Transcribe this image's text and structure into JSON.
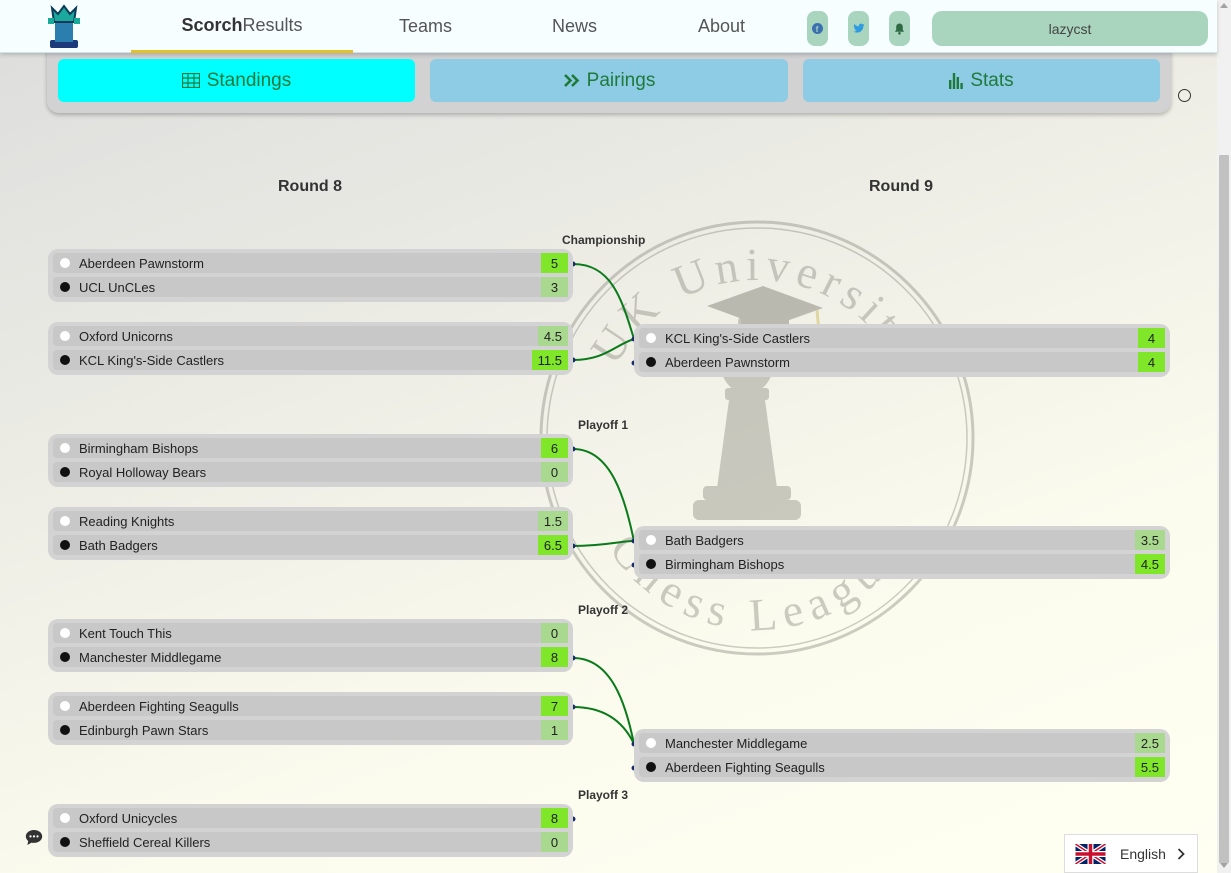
{
  "navbar": {
    "brand_bold": "Scorch",
    "brand_rest": "Results",
    "links": [
      {
        "label": "Teams"
      },
      {
        "label": "News"
      },
      {
        "label": "About"
      }
    ],
    "user_label": "lazycst"
  },
  "tabs": [
    {
      "label": "Standings",
      "icon": "grid-icon",
      "active": true
    },
    {
      "label": "Pairings",
      "icon": "chevrons-right-icon",
      "active": false
    },
    {
      "label": "Stats",
      "icon": "bar-chart-icon",
      "active": false
    }
  ],
  "rounds": {
    "left_title": "Round 8",
    "right_title": "Round 9"
  },
  "groups": [
    {
      "label": "Championship"
    },
    {
      "label": "Playoff 1"
    },
    {
      "label": "Playoff 2"
    },
    {
      "label": "Playoff 3"
    }
  ],
  "round8_matches": [
    {
      "white": "Aberdeen Pawnstorm",
      "white_score": "5",
      "black": "UCL UnCLes",
      "black_score": "3"
    },
    {
      "white": "Oxford Unicorns",
      "white_score": "4.5",
      "black": "KCL King's-Side Castlers",
      "black_score": "11.5"
    },
    {
      "white": "Birmingham Bishops",
      "white_score": "6",
      "black": "Royal Holloway Bears",
      "black_score": "0"
    },
    {
      "white": "Reading Knights",
      "white_score": "1.5",
      "black": "Bath Badgers",
      "black_score": "6.5"
    },
    {
      "white": "Kent Touch This",
      "white_score": "0",
      "black": "Manchester Middlegame",
      "black_score": "8"
    },
    {
      "white": "Aberdeen Fighting Seagulls",
      "white_score": "7",
      "black": "Edinburgh Pawn Stars",
      "black_score": "1"
    },
    {
      "white": "Oxford Unicycles",
      "white_score": "8",
      "black": "Sheffield Cereal Killers",
      "black_score": "0"
    }
  ],
  "round9_matches": [
    {
      "white": "KCL King's-Side Castlers",
      "white_score": "4",
      "black": "Aberdeen Pawnstorm",
      "black_score": "4"
    },
    {
      "white": "Bath Badgers",
      "white_score": "3.5",
      "black": "Birmingham Bishops",
      "black_score": "4.5"
    },
    {
      "white": "Manchester Middlegame",
      "white_score": "2.5",
      "black": "Aberdeen Fighting Seagulls",
      "black_score": "5.5"
    }
  ],
  "watermark": {
    "top_text": "UK University",
    "bottom_text": "Chess League"
  },
  "language": {
    "label": "English"
  },
  "colors": {
    "accent_tab": "#00ffff",
    "tab": "#8ecbe5",
    "win_score": "#7fe62a",
    "connector": "#0a7a1a"
  }
}
